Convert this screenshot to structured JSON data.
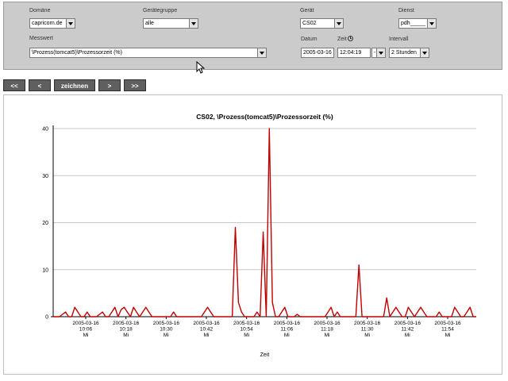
{
  "filters": {
    "domain_label": "Domäne",
    "domain_value": "capricorn.de",
    "device_group_label": "Gerätegruppe",
    "device_group_value": "alle",
    "device_label": "Gerät",
    "device_value": "CS02",
    "service_label": "Dienst",
    "service_value": "pdh_____",
    "metric_label": "Messwert",
    "metric_value": "\\Prozess(tomcat5)\\Prozessorzeit (%)",
    "date_label": "Datum",
    "date_value": "2005-03-16",
    "time_label": "Zeit",
    "time_value": "12:04:19",
    "time_mod_value": "-",
    "interval_label": "Intervall",
    "interval_value": "2 Stunden"
  },
  "nav": {
    "first_label": "<<",
    "prev_label": "<",
    "draw_label": "zeichnen",
    "next_label": ">",
    "last_label": ">>"
  },
  "colors": {
    "series": "#c00000",
    "panel": "#cbcbcb",
    "nav_button": "#5f5f5f"
  },
  "chart_data": {
    "type": "line",
    "title": "CS02, \\Prozess(tomcat5)\\Prozessorzeit (%)",
    "xlabel": "Zeit",
    "ylabel": "",
    "ylim": [
      0,
      40
    ],
    "yticks": [
      0,
      10,
      20,
      30,
      40
    ],
    "grid": true,
    "x_tick_labels": [
      {
        "date": "2005-03-16",
        "time": "10:06",
        "day": "Mi"
      },
      {
        "date": "2005-03-16",
        "time": "10:18",
        "day": "Mi"
      },
      {
        "date": "2005-03-16",
        "time": "10:30",
        "day": "Mi"
      },
      {
        "date": "2005-03-16",
        "time": "10:42",
        "day": "Mi"
      },
      {
        "date": "2005-03-16",
        "time": "10:54",
        "day": "Mi"
      },
      {
        "date": "2005-03-16",
        "time": "11:06",
        "day": "Mi"
      },
      {
        "date": "2005-03-16",
        "time": "11:18",
        "day": "Mi"
      },
      {
        "date": "2005-03-16",
        "time": "11:30",
        "day": "Mi"
      },
      {
        "date": "2005-03-16",
        "time": "11:42",
        "day": "Mi"
      },
      {
        "date": "2005-03-16",
        "time": "11:54",
        "day": "Mi"
      }
    ],
    "series": [
      {
        "values": [
          0,
          0,
          0,
          0.5,
          1,
          0,
          0,
          2,
          1,
          0,
          0,
          1,
          0,
          0,
          0,
          0.5,
          1,
          0,
          0,
          1,
          2,
          0,
          1.5,
          2,
          1,
          0,
          2,
          1,
          0,
          1,
          2,
          1,
          0,
          0,
          0,
          0,
          0,
          0,
          0,
          1,
          0,
          0,
          0,
          0,
          0,
          0,
          0,
          0,
          0,
          1,
          2,
          1,
          0,
          0,
          0,
          0,
          0,
          0,
          0,
          19,
          3,
          1,
          0,
          0,
          0,
          0,
          1,
          0,
          18,
          0,
          40,
          3,
          0,
          0,
          1,
          2,
          0,
          0,
          0,
          0.5,
          0,
          0,
          0,
          0,
          0,
          0,
          0,
          0,
          0,
          1,
          2,
          0,
          1,
          0,
          0,
          0,
          0,
          0,
          0,
          11,
          0,
          0,
          0,
          0,
          0,
          0,
          0,
          0,
          4,
          0,
          1,
          2,
          1,
          0,
          0,
          2,
          1,
          0,
          1,
          2,
          1,
          0,
          0,
          0,
          0,
          1,
          0,
          0,
          0,
          0,
          2,
          1,
          0,
          0,
          1,
          2,
          0,
          0
        ]
      }
    ]
  }
}
